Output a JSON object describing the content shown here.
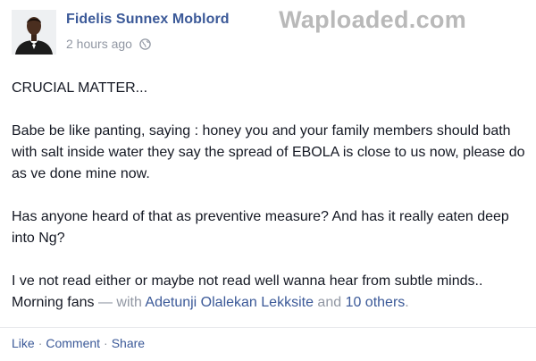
{
  "post": {
    "author": "Fidelis Sunnex Moblord",
    "timestamp": "2 hours ago",
    "audience_icon": "globe-icon",
    "watermark": "Waploaded.com",
    "paragraphs": {
      "p1": "CRUCIAL MATTER...",
      "p2": "Babe be like panting, saying : honey you and your family members should bath with salt inside water they say the spread of EBOLA is close to us now, please do as ve done mine now.",
      "p3": "Has anyone heard of that as preventive measure? And has it really eaten deep into Ng?",
      "p4": "I ve not read either or maybe not read well wanna hear from subtle minds.. Morning fans"
    },
    "tag": {
      "with": " — with ",
      "person": "Adetunji Olalekan Lekksite",
      "and": " and ",
      "others": "10 others",
      "end": "."
    },
    "actions": {
      "like": "Like",
      "comment": "Comment",
      "share": "Share",
      "separator": "·"
    }
  },
  "colors": {
    "link": "#3b5998",
    "meta": "#9197a3",
    "text": "#141823",
    "watermark": "#b9b9b9"
  }
}
